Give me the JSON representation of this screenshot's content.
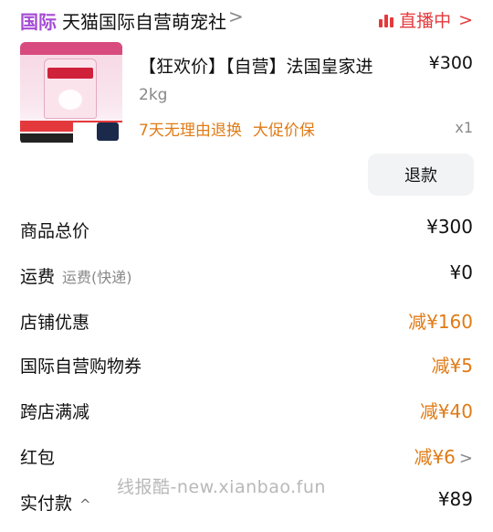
{
  "header": {
    "badge": "国际",
    "store_name": "天猫国际自营萌宠社",
    "store_chevron": ">",
    "live_label": "直播中",
    "live_chevron": ">"
  },
  "product": {
    "title": "【狂欢价】【自营】法国皇家进",
    "price": "¥300",
    "spec": "2kg",
    "tags": [
      "7天无理由退换",
      "大促价保"
    ],
    "quantity": "x1",
    "image_icon": "royal-canin-cat-food-bag"
  },
  "actions": {
    "refund_label": "退款"
  },
  "summary": {
    "rows": [
      {
        "label": "商品总价",
        "sub": "",
        "value": "¥300",
        "discount": false
      },
      {
        "label": "运费",
        "sub": "运费(快递)",
        "value": "¥0",
        "discount": false
      },
      {
        "label": "店铺优惠",
        "sub": "",
        "value": "减¥160",
        "discount": true
      },
      {
        "label": "国际自营购物券",
        "sub": "",
        "value": "减¥5",
        "discount": true
      },
      {
        "label": "跨店满减",
        "sub": "",
        "value": "减¥40",
        "discount": true
      },
      {
        "label": "红包",
        "sub": "",
        "value": "减¥6",
        "discount": true,
        "chevron": ">"
      },
      {
        "label": "实付款",
        "sub": "",
        "value": "¥89",
        "discount": false,
        "caret": "^"
      }
    ]
  },
  "watermark": "线报酷-new.xianbao.fun",
  "colors": {
    "intl_purple": "#a64bd6",
    "live_red": "#e4393c",
    "discount_orange": "#e07b16"
  }
}
